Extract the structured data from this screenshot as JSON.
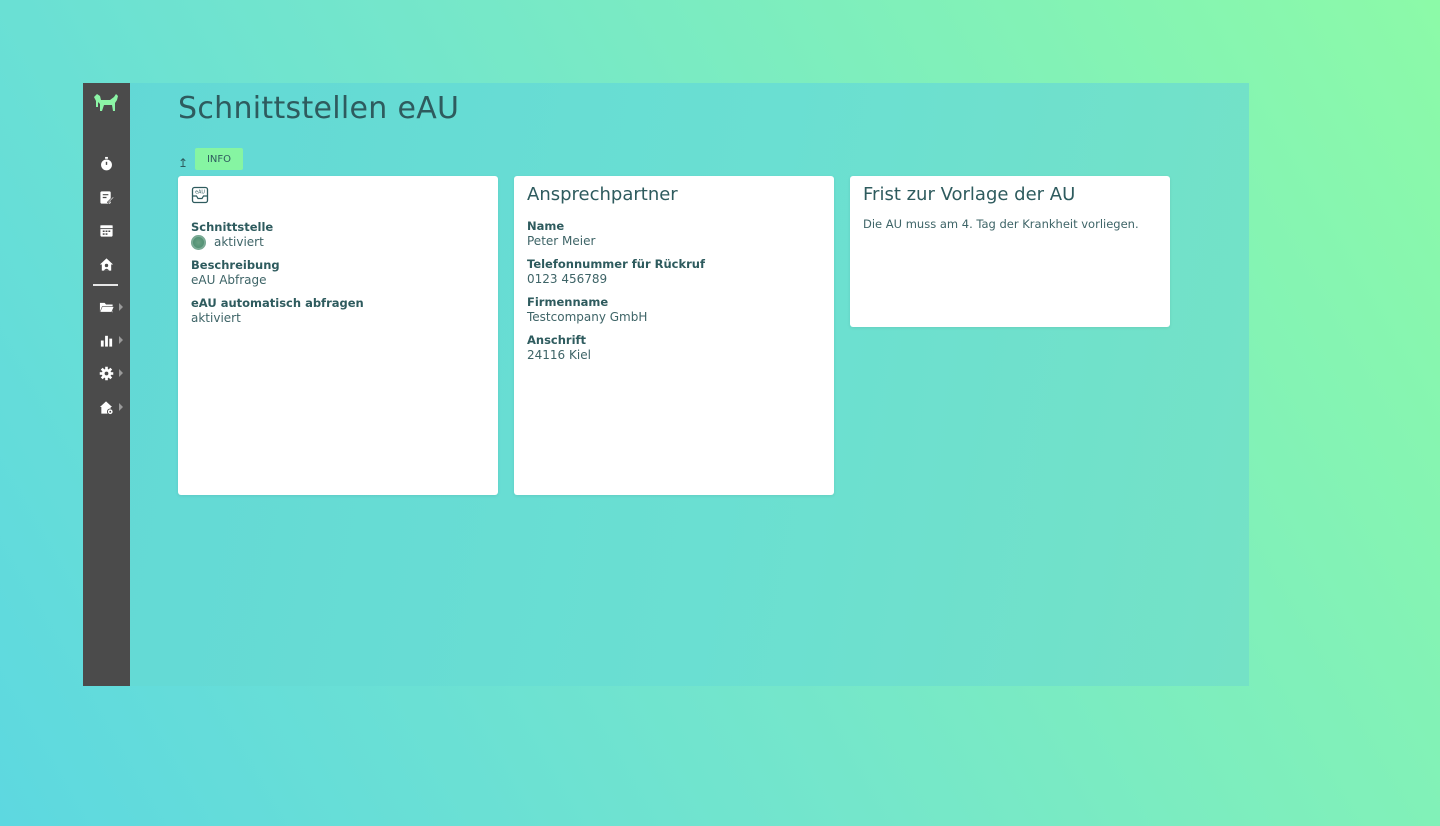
{
  "header": {
    "title": "Schnittstellen eAU",
    "back_arrow": "↥",
    "tab_info": "INFO"
  },
  "sidebar": {
    "items": [
      {
        "icon": "stopwatch-icon",
        "has_submenu": false
      },
      {
        "icon": "edit-note-icon",
        "has_submenu": false
      },
      {
        "icon": "calendar-icon",
        "has_submenu": false
      },
      {
        "icon": "home-person-icon",
        "has_submenu": false
      },
      {
        "icon": "folder-icon",
        "has_submenu": true
      },
      {
        "icon": "bar-chart-icon",
        "has_submenu": true
      },
      {
        "icon": "gear-icon",
        "has_submenu": true
      },
      {
        "icon": "home-settings-icon",
        "has_submenu": true
      }
    ]
  },
  "interface_card": {
    "icon_text": "eAU",
    "fields": [
      {
        "label": "Schnittstelle",
        "value": "aktiviert"
      },
      {
        "label": "Beschreibung",
        "value": "eAU Abfrage"
      },
      {
        "label": "eAU automatisch abfragen",
        "value": "aktiviert"
      }
    ]
  },
  "contact_card": {
    "title": "Ansprechpartner",
    "fields": [
      {
        "label": "Name",
        "value": "Peter Meier"
      },
      {
        "label": "Telefonnummer für Rückruf",
        "value": "0123 456789"
      },
      {
        "label": "Firmenname",
        "value": "Testcompany GmbH"
      },
      {
        "label": "Anschrift",
        "value": "24116 Kiel"
      }
    ]
  },
  "deadline_card": {
    "title": "Frist zur Vorlage der AU",
    "text": "Die AU muss am 4. Tag der Krankheit vorliegen."
  },
  "colors": {
    "sidebar": "#4b4b4b",
    "accent": "#86f5a2",
    "text": "#2e5b5e",
    "card": "#ffffff"
  }
}
